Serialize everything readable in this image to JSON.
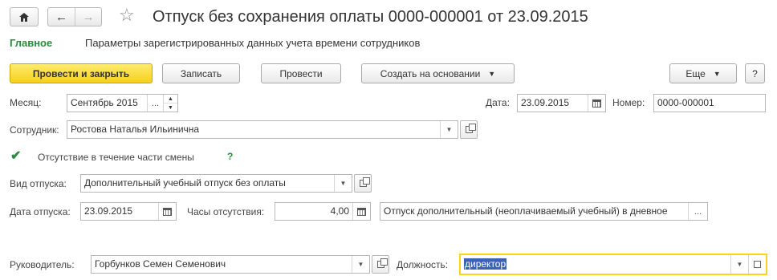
{
  "title_bar": {
    "title": "Отпуск без сохранения оплаты 0000-000001 от 23.09.2015",
    "home_icon": "home-icon",
    "back_icon": "arrow-left-icon",
    "forward_icon": "arrow-right-icon",
    "favorite_icon": "star-icon"
  },
  "tabs": [
    {
      "label": "Главное",
      "active": true
    },
    {
      "label": "Параметры зарегистрированных данных учета времени сотрудников",
      "active": false
    }
  ],
  "toolbar": {
    "post_close": "Провести и закрыть",
    "save": "Записать",
    "post": "Провести",
    "create_based": "Создать на основании",
    "more": "Еще",
    "help": "?"
  },
  "form": {
    "month_label": "Месяц:",
    "month_value": "Сентябрь 2015",
    "date_label": "Дата:",
    "date_value": "23.09.2015",
    "number_label": "Номер:",
    "number_value": "0000-000001",
    "employee_label": "Сотрудник:",
    "employee_value": "Ростова Наталья Ильинична",
    "partial_shift_label": "Отсутствие в течение части смены",
    "partial_shift_checked": true,
    "partial_shift_help": "?",
    "leave_type_label": "Вид отпуска:",
    "leave_type_value": "Дополнительный учебный отпуск без оплаты",
    "leave_date_label": "Дата отпуска:",
    "leave_date_value": "23.09.2015",
    "hours_label": "Часы отсутствия:",
    "hours_value": "4,00",
    "description_value": "Отпуск дополнительный (неоплачиваемый учебный) в дневное",
    "manager_label": "Руководитель:",
    "manager_value": "Горбунков Семен Семенович",
    "position_label": "Должность:",
    "position_value": "директор"
  },
  "colors": {
    "accent_green": "#2a8a3e",
    "primary_button": "#f5d019",
    "focus_border": "#ffd21f",
    "selection": "#3a63b5"
  }
}
